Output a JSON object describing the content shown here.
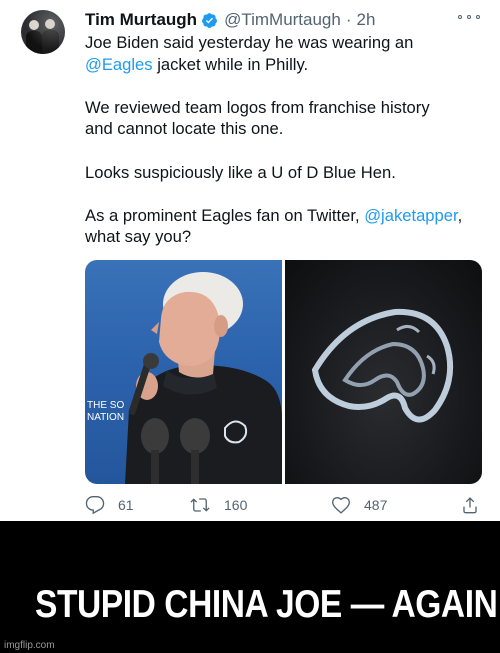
{
  "tweet": {
    "author_name": "Tim Murtaugh",
    "handle": "@TimMurtaugh",
    "separator": "·",
    "time": "2h",
    "verified_color": "#1d9bf0",
    "line1": "Joe Biden said yesterday he was wearing an",
    "mention_eagles": "@Eagles",
    "line2_rest": " jacket while in Philly.",
    "para2_line1": "We reviewed team logos from franchise history",
    "para2_line2": "and cannot locate this one.",
    "para3": "Looks suspiciously like a U of D Blue Hen.",
    "para4_start": "As a prominent Eagles fan on Twitter, ",
    "mention_tapper": "@jaketapper",
    "para4_end": ",",
    "para4_line2": "what say you?",
    "media": {
      "left_sign_text_1": "THE SO",
      "left_sign_text_2": "NATION"
    },
    "actions": {
      "reply_count": "61",
      "retweet_count": "160",
      "like_count": "487"
    },
    "icons": [
      "more-icon",
      "verified-icon",
      "reply-icon",
      "retweet-icon",
      "like-icon",
      "share-icon"
    ]
  },
  "meme": {
    "caption": "STUPID CHINA JOE — AGAIN!",
    "watermark": "imgflip.com"
  },
  "colors": {
    "link": "#1d9bf0",
    "muted": "#536471",
    "caption_band": "#000000"
  }
}
